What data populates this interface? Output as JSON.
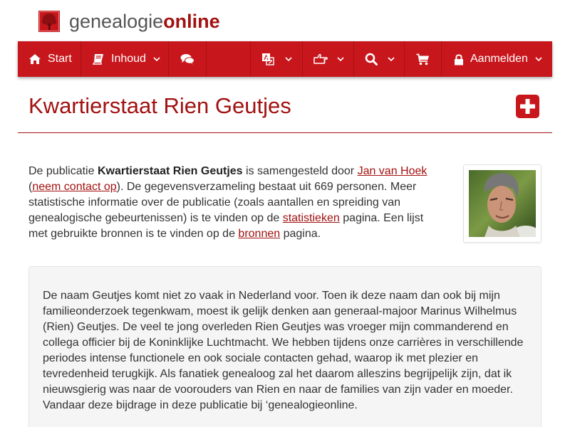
{
  "brand": {
    "part1": "genealogie",
    "part2": "online"
  },
  "nav": {
    "start_label": "Start",
    "inhoud_label": "Inhoud",
    "aanmelden_label": "Aanmelden"
  },
  "page": {
    "title": "Kwartierstaat Rien Geutjes"
  },
  "intro": {
    "t1": "De publicatie ",
    "pub_name": "Kwartierstaat Rien Geutjes",
    "t2": " is samengesteld door ",
    "author_link": "Jan van Hoek",
    "t3": "(",
    "contact_link": "neem contact op",
    "t4": "). De gegevensverzameling bestaat uit 669 personen. Meer statistische informatie over de publicatie (zoals aantallen en spreiding van genealogische gebeurtenissen) is te vinden op de ",
    "stats_link": "statistieken",
    "t5": " pagina. Een lijst met gebruikte bronnen is te vinden op de ",
    "sources_link": "bronnen",
    "t6": " pagina."
  },
  "story": {
    "text": "De naam Geutjes komt niet zo vaak in Nederland voor. Toen ik deze naam dan ook bij mijn familieonderzoek tegenkwam, moest ik gelijk denken aan generaal-majoor Marinus Wilhelmus (Rien) Geutjes. De veel te jong overleden Rien Geutjes was vroeger mijn commanderend en collega officier bij de Koninklijke Luchtmacht. We hebben tijdens onze carrières in verschillende periodes intense functionele en ook sociale contacten gehad, waarop ik met plezier en tevredenheid terugkijk. Als fanatiek genealoog zal het daarom alleszins begrijpelijk zijn, dat ik nieuwsgierig was naar de voorouders van Rien en naar de families van zijn vader en moeder. Vandaar deze bijdrage in deze publicatie bij ‘genealogieonline."
  },
  "icons": {
    "logo": "tree-icon",
    "start": "home-icon",
    "inhoud": "book-icon",
    "forum": "comments-icon",
    "language": "translate-icon",
    "share": "hand-pointing-icon",
    "search": "search-icon",
    "cart": "shopping-cart-icon",
    "login": "lock-icon",
    "add": "plus-icon"
  },
  "colors": {
    "brand_red": "#c8171c",
    "title_red": "#a21111",
    "text": "#333333"
  }
}
